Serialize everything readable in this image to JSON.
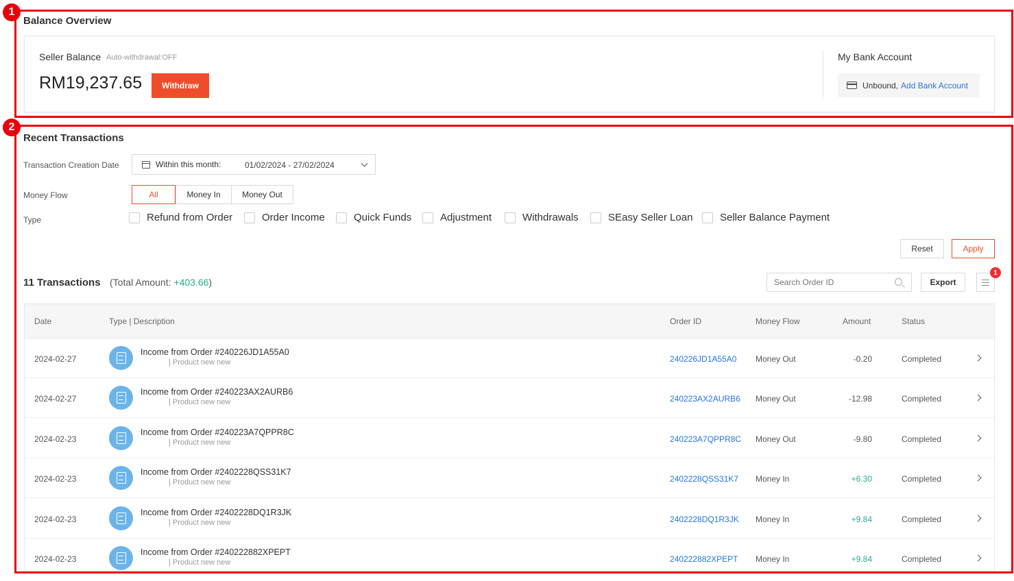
{
  "annotations": [
    {
      "number": "1"
    },
    {
      "number": "2"
    }
  ],
  "balance_overview": {
    "title": "Balance Overview",
    "seller_balance_label": "Seller Balance",
    "auto_withdrawal": "Auto-withdrawal:OFF",
    "amount": "RM19,237.65",
    "withdraw_label": "Withdraw",
    "bank_title": "My Bank Account",
    "bank_status": "Unbound,",
    "add_bank_link": "Add Bank Account"
  },
  "recent_transactions": {
    "title": "Recent Transactions",
    "date_filter_label": "Transaction Creation Date",
    "date_preset": "Within this month:",
    "date_range": "01/02/2024 - 27/02/2024",
    "money_flow_label": "Money Flow",
    "money_flow_options": [
      "All",
      "Money In",
      "Money Out"
    ],
    "money_flow_selected": "All",
    "type_label": "Type",
    "type_options": [
      "Refund from Order",
      "Order Income",
      "Quick Funds",
      "Adjustment",
      "Withdrawals",
      "SEasy Seller Loan",
      "Seller Balance Payment"
    ],
    "reset_label": "Reset",
    "apply_label": "Apply",
    "count_text": "11 Transactions",
    "total_prefix": "(Total Amount: ",
    "total_value": "+403.66",
    "total_suffix": ")",
    "search_placeholder": "Search Order ID",
    "export_label": "Export",
    "list_badge": "1"
  },
  "table": {
    "headers": {
      "date": "Date",
      "type_desc": "Type | Description",
      "order_id": "Order ID",
      "money_flow": "Money Flow",
      "amount": "Amount",
      "status": "Status"
    },
    "rows": [
      {
        "date": "2024-02-27",
        "title": "Income from Order #240226JD1A55A0",
        "sub": "| Product new new",
        "order_id": "240226JD1A55A0",
        "flow": "Money Out",
        "amount": "-0.20",
        "status": "Completed",
        "positive": false
      },
      {
        "date": "2024-02-27",
        "title": "Income from Order #240223AX2AURB6",
        "sub": "| Product new new",
        "order_id": "240223AX2AURB6",
        "flow": "Money Out",
        "amount": "-12.98",
        "status": "Completed",
        "positive": false
      },
      {
        "date": "2024-02-23",
        "title": "Income from Order #240223A7QPPR8C",
        "sub": "| Product new new",
        "order_id": "240223A7QPPR8C",
        "flow": "Money Out",
        "amount": "-9.80",
        "status": "Completed",
        "positive": false
      },
      {
        "date": "2024-02-23",
        "title": "Income from Order #2402228QSS31K7",
        "sub": "| Product new new",
        "order_id": "2402228QSS31K7",
        "flow": "Money In",
        "amount": "+6.30",
        "status": "Completed",
        "positive": true
      },
      {
        "date": "2024-02-23",
        "title": "Income from Order #2402228DQ1R3JK",
        "sub": "| Product new new",
        "order_id": "2402228DQ1R3JK",
        "flow": "Money In",
        "amount": "+9.84",
        "status": "Completed",
        "positive": true
      },
      {
        "date": "2024-02-23",
        "title": "Income from Order #240222882XPEPT",
        "sub": "| Product new new",
        "order_id": "240222882XPEPT",
        "flow": "Money In",
        "amount": "+9.84",
        "status": "Completed",
        "positive": true
      }
    ]
  }
}
